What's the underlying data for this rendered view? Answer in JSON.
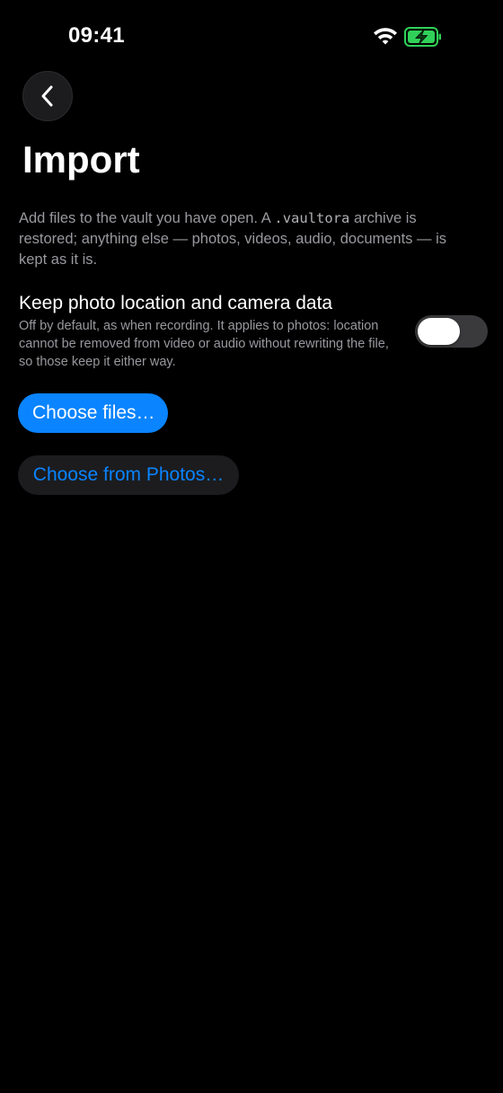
{
  "status_bar": {
    "time": "09:41",
    "wifi_icon": "wifi-icon",
    "battery_icon": "battery-charging-icon",
    "battery_color": "#30d158"
  },
  "nav": {
    "back_icon": "chevron-left-icon"
  },
  "page": {
    "title": "Import",
    "description_before": "Add files to the vault you have open. A ",
    "description_code": ".vaultora",
    "description_after": " archive is restored; anything else — photos, videos, audio, documents — is kept as it is."
  },
  "settings": {
    "keep_metadata": {
      "label": "Keep photo location and camera data",
      "hint": "Off by default, as when recording. It applies to photos: location cannot be removed from video or audio without rewriting the file, so those keep it either way.",
      "enabled": false
    }
  },
  "actions": {
    "choose_files_label": "Choose files…",
    "choose_photos_label": "Choose from Photos…"
  },
  "colors": {
    "accent": "#0a84ff",
    "background": "#000000",
    "secondary_text": "#98989e",
    "toggle_off": "#3a3a3c"
  }
}
